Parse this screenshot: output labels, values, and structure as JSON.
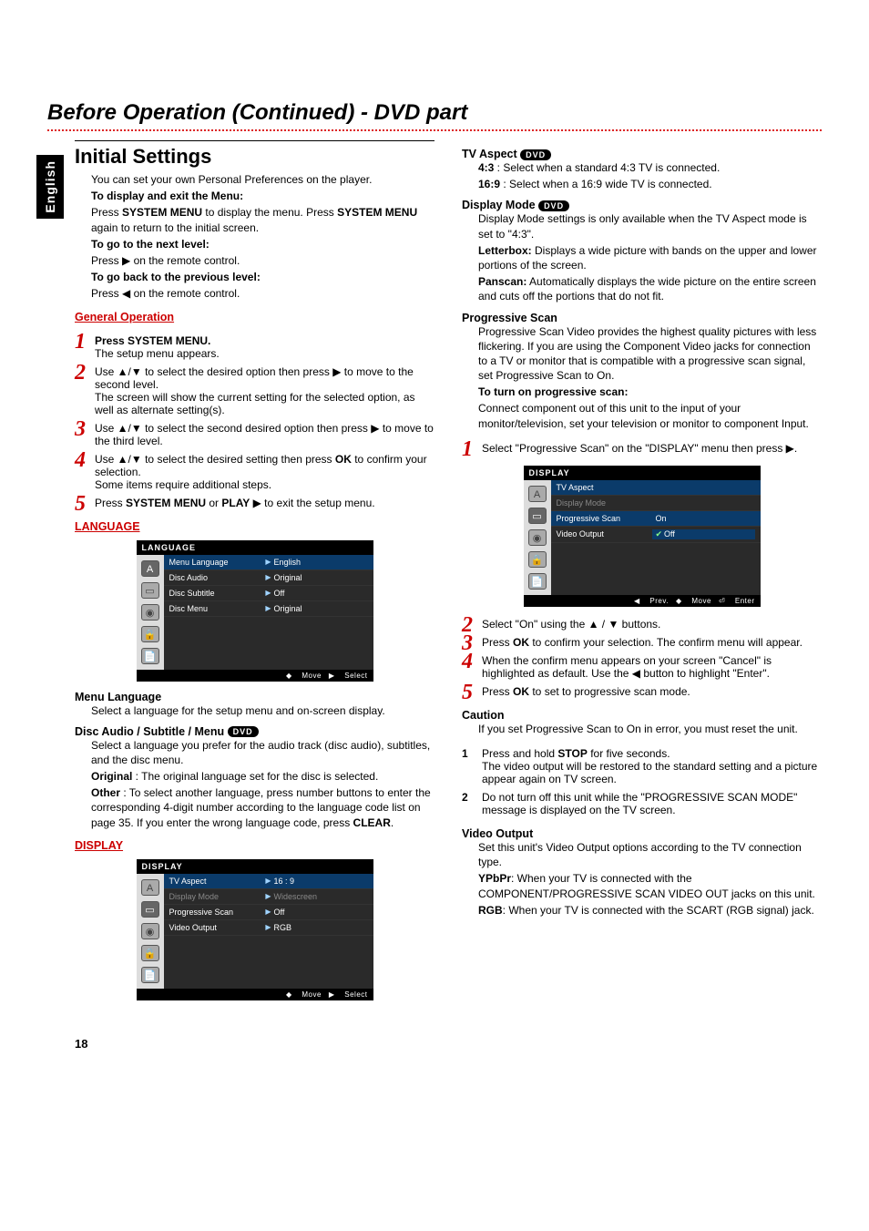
{
  "lang_tab": "English",
  "chapter_title": "Before Operation (Continued) - DVD part",
  "section_title": "Initial Settings",
  "intro": "You can set your own Personal Preferences on the player.",
  "display_exit_hdg": "To display and exit the Menu:",
  "display_exit_text1a": "Press ",
  "display_exit_text1_bold": "SYSTEM MENU",
  "display_exit_text1b": " to display the menu. Press ",
  "display_exit_text1c": " again to return to the initial screen.",
  "next_level_hdg": "To go to the next level:",
  "next_level_text": "Press ▶ on the remote control.",
  "prev_level_hdg": "To go back to the previous level:",
  "prev_level_text": "Press ◀ on the remote control.",
  "genop_hdg": "General Operation",
  "step1a": "Press SYSTEM MENU.",
  "step1b": "The setup menu appears.",
  "step2a": "Use ▲/▼ to select the desired option then press ▶ to move to the second level.",
  "step2b": "The screen will show the current setting for the selected option, as well as alternate setting(s).",
  "step3": "Use ▲/▼ to select the second desired option then press ▶ to move to the third level.",
  "step4a": "Use ▲/▼ to select the desired setting then press ",
  "step4_ok": "OK",
  "step4b": " to confirm your selection.",
  "step4c": "Some items require additional steps.",
  "step5a": "Press ",
  "step5_b1": "SYSTEM MENU",
  "step5_mid": " or ",
  "step5_b2": "PLAY",
  "step5b": " ▶ to exit the setup menu.",
  "language_hdg": "LANGUAGE",
  "osd_lang": {
    "title": "LANGUAGE",
    "rows": [
      {
        "label": "Menu Language",
        "val": "English",
        "sel": true
      },
      {
        "label": "Disc Audio",
        "val": "Original"
      },
      {
        "label": "Disc Subtitle",
        "val": "Off"
      },
      {
        "label": "Disc Menu",
        "val": "Original"
      }
    ],
    "footer_move": "Move",
    "footer_select": "Select"
  },
  "menu_lang_hdg": "Menu Language",
  "menu_lang_text": "Select a language for the setup menu and on-screen display.",
  "disc_asm_hdg": "Disc Audio / Subtitle / Menu",
  "disc_asm_text1": "Select a language you prefer for the audio track (disc audio), subtitles, and the disc menu.",
  "disc_asm_orig_b": "Original",
  "disc_asm_orig": " : The original language set for the disc is selected.",
  "disc_asm_other_b": "Other",
  "disc_asm_other": " : To select another language, press number buttons to enter the corresponding 4-digit number according to the language code list on page 35. If you enter the wrong language code, press ",
  "disc_asm_clear": "CLEAR",
  "display_hdg": "DISPLAY",
  "osd_disp": {
    "title": "DISPLAY",
    "rows": [
      {
        "label": "TV Aspect",
        "val": "16 : 9",
        "sel": true
      },
      {
        "label": "Display Mode",
        "val": "Widescreen",
        "dim": true
      },
      {
        "label": "Progressive Scan",
        "val": "Off"
      },
      {
        "label": "Video Output",
        "val": "RGB"
      }
    ],
    "footer_move": "Move",
    "footer_select": "Select"
  },
  "tvaspect_hdg": "TV Aspect",
  "tvaspect_43_b": "4:3",
  "tvaspect_43": " : Select when a standard 4:3 TV is connected.",
  "tvaspect_169_b": "16:9",
  "tvaspect_169": " : Select when a 16:9 wide TV is connected.",
  "dispmode_hdg": "Display Mode",
  "dispmode_intro": "Display Mode settings is only available when the TV Aspect mode is set to \"4:3\".",
  "dispmode_lb_b": "Letterbox:",
  "dispmode_lb": " Displays a wide picture with bands on the upper and lower portions of the screen.",
  "dispmode_ps_b": "Panscan:",
  "dispmode_ps": " Automatically displays the wide picture on the entire screen and cuts off the portions that do not fit.",
  "prog_hdg": "Progressive Scan",
  "prog_intro": "Progressive Scan Video provides the highest quality pictures with less flickering. If you are using the Component Video jacks for connection to a TV or monitor that is compatible with a progressive scan signal, set Progressive Scan to On.",
  "prog_turnon_hdg": "To turn on progressive scan:",
  "prog_turnon_text": "Connect component out of this unit to the input of your monitor/television, set your television or monitor to component Input.",
  "pstep1": "Select \"Progressive Scan\" on the \"DISPLAY\" menu then press ▶.",
  "osd_prog": {
    "title": "DISPLAY",
    "rows": [
      {
        "label": "TV Aspect",
        "val": ""
      },
      {
        "label": "Display Mode",
        "val": "",
        "dim": true
      },
      {
        "label": "Progressive Scan",
        "val": "On",
        "sel": true
      },
      {
        "label": "Video Output",
        "val": "✓ Off",
        "valsel": true
      }
    ],
    "footer_prev": "Prev.",
    "footer_move": "Move",
    "footer_enter": "Enter"
  },
  "pstep2": "Select \"On\" using the ▲ / ▼ buttons.",
  "pstep3a": "Press ",
  "pstep3_ok": "OK",
  "pstep3b": " to confirm your selection. The confirm menu will appear.",
  "pstep4": "When the confirm menu appears on your screen \"Cancel\" is highlighted as default. Use the ◀ button to highlight \"Enter\".",
  "pstep5a": "Press ",
  "pstep5_ok": "OK",
  "pstep5b": " to set to progressive scan mode.",
  "caution_hdg": "Caution",
  "caution_intro": "If you set Progressive Scan to On in error, you must reset the unit.",
  "caution1a": "Press and hold ",
  "caution1_stop": "STOP",
  "caution1b": " for five seconds.",
  "caution1c": "The video output will be restored to the standard setting and a picture appear again on TV screen.",
  "caution2": "Do not turn off this unit while the \"PROGRESSIVE SCAN MODE\" message is displayed on the TV screen.",
  "vout_hdg": "Video Output",
  "vout_intro": "Set this unit's Video Output options according to the TV connection type.",
  "vout_ypbpr_b": "YPbPr",
  "vout_ypbpr": ": When your TV is connected with the COMPONENT/PROGRESSIVE SCAN VIDEO OUT jacks on this unit.",
  "vout_rgb_b": "RGB",
  "vout_rgb": ": When your TV is connected with the SCART (RGB signal) jack.",
  "dvd_badge": "DVD",
  "page_number": "18"
}
